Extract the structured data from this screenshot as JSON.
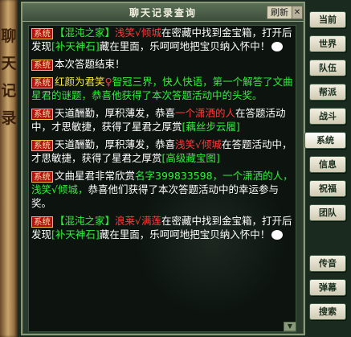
{
  "scroll_deco": {
    "chars": [
      "聊",
      "天",
      "记",
      "录"
    ]
  },
  "window": {
    "title": "聊天记录查询",
    "refresh_label": "刷新",
    "close_label": "✕"
  },
  "messages": [
    {
      "parts": [
        {
          "t": "系统",
          "c": "tag"
        },
        {
          "t": "【混沌之家】",
          "c": "green"
        },
        {
          "t": "浅笑√倾城",
          "c": "red"
        },
        {
          "t": "在密藏中找到金宝箱，打开后发现",
          "c": "white"
        },
        {
          "t": "[补天神石]",
          "c": "green"
        },
        {
          "t": "藏在里面，乐呵呵地把宝贝纳入怀中！",
          "c": "white"
        }
      ],
      "face": true
    },
    {
      "parts": [
        {
          "t": "系统",
          "c": "tag"
        },
        {
          "t": "本次答题结束！",
          "c": "white"
        }
      ]
    },
    {
      "parts": [
        {
          "t": "系统",
          "c": "tag"
        },
        {
          "t": "红颜为君笑",
          "c": "yellow"
        },
        {
          "t": "♀",
          "c": "red"
        },
        {
          "t": "智冠三界，快人快语，第一个解答了文曲星君的谜题，恭喜他获得了本次答题活动中的头奖。",
          "c": "green"
        }
      ]
    },
    {
      "parts": [
        {
          "t": "系统",
          "c": "tag"
        },
        {
          "t": "天道酬勤，厚积薄发，恭喜",
          "c": "white"
        },
        {
          "t": "一个潇洒的人",
          "c": "red"
        },
        {
          "t": "在答题活动中，才思敏捷，获得了星君之厚赏",
          "c": "white"
        },
        {
          "t": "[藕丝步云履]",
          "c": "green"
        }
      ]
    },
    {
      "parts": [
        {
          "t": "系统",
          "c": "tag"
        },
        {
          "t": "天道酬勤，厚积薄发，恭喜",
          "c": "white"
        },
        {
          "t": "浅笑√倾城",
          "c": "red"
        },
        {
          "t": "在答题活动中，才思敏捷，获得了星君之厚赏",
          "c": "white"
        },
        {
          "t": "[高级藏宝图]",
          "c": "green"
        }
      ]
    },
    {
      "parts": [
        {
          "t": "系统",
          "c": "tag"
        },
        {
          "t": "文曲星君非常欣赏",
          "c": "white"
        },
        {
          "t": "名字399833598，一个潇洒的人，浅笑√倾城，",
          "c": "green"
        },
        {
          "t": "恭喜他们获得了本次答题活动中的幸运参与奖。",
          "c": "white"
        }
      ]
    },
    {
      "parts": [
        {
          "t": "系统",
          "c": "tag"
        },
        {
          "t": "【混沌之家】",
          "c": "green"
        },
        {
          "t": "浪莱√满莲",
          "c": "red"
        },
        {
          "t": "在密藏中找到金宝箱，打开后发现",
          "c": "white"
        },
        {
          "t": "[补天神石]",
          "c": "green"
        },
        {
          "t": "藏在里面，乐呵呵地把宝贝纳入怀中！",
          "c": "white"
        }
      ],
      "face": true
    }
  ],
  "tabs": [
    {
      "label": "当前",
      "name": "tab-current",
      "active": false
    },
    {
      "label": "世界",
      "name": "tab-world",
      "active": false
    },
    {
      "label": "队伍",
      "name": "tab-team",
      "active": false
    },
    {
      "label": "帮派",
      "name": "tab-guild",
      "active": false
    },
    {
      "label": "战斗",
      "name": "tab-battle",
      "active": false
    },
    {
      "label": "系统",
      "name": "tab-system",
      "active": true
    },
    {
      "label": "信息",
      "name": "tab-info",
      "active": false
    },
    {
      "label": "祝福",
      "name": "tab-blessing",
      "active": false
    },
    {
      "label": "团队",
      "name": "tab-group",
      "active": false
    },
    {
      "label": "传音",
      "name": "tab-whisper",
      "active": false
    },
    {
      "label": "弹幕",
      "name": "tab-barrage",
      "active": false
    },
    {
      "label": "搜索",
      "name": "tab-search",
      "active": false
    }
  ]
}
